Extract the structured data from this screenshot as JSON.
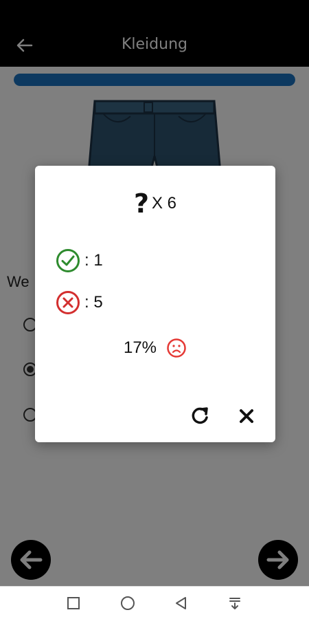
{
  "app_bar": {
    "title": "Kleidung",
    "back_icon": "arrow-left-icon"
  },
  "progress": {
    "fraction": 1.0,
    "color": "#1a73c0"
  },
  "question": {
    "visible_text": "We"
  },
  "options": [
    {
      "checked": false
    },
    {
      "checked": true
    },
    {
      "checked": false
    }
  ],
  "dialog": {
    "question_count_label": "X 6",
    "correct_label": ": 1",
    "wrong_label": ": 5",
    "percent_label": "17%",
    "colors": {
      "correct": "#2e8b2e",
      "wrong": "#d32f2f",
      "face": "#e53935"
    }
  },
  "system_nav": [
    "square-icon",
    "circle-icon",
    "triangle-back-icon",
    "download-icon"
  ]
}
